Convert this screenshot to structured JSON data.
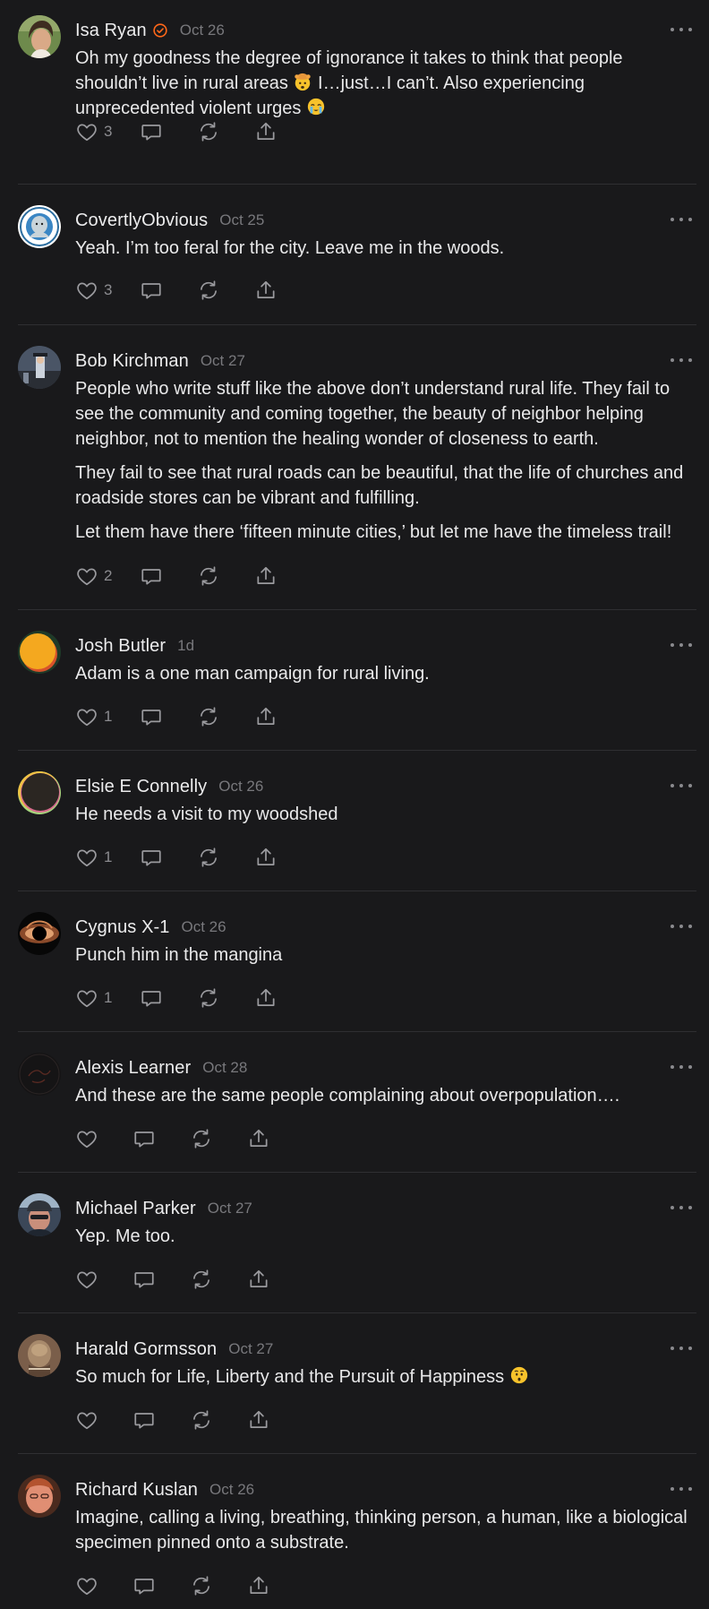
{
  "comments": [
    {
      "author": "Isa Ryan",
      "verified": true,
      "date": "Oct 26",
      "avatar": "avatar-isa",
      "paragraphs": [
        [
          {
            "t": "Oh my goodness the degree of ignorance it takes to think that people shouldn’t live in rural areas "
          },
          {
            "emoji": "exploding-head"
          },
          {
            "t": " I…just…I can’t. Also experiencing unprecedented violent urges "
          },
          {
            "emoji": "crying-face"
          }
        ]
      ],
      "likes": "3"
    },
    {
      "author": "CovertlyObvious",
      "date": "Oct 25",
      "avatar": "avatar-covertly",
      "paragraphs": [
        [
          {
            "t": "Yeah. I’m too feral for the city. Leave me in the woods."
          }
        ]
      ],
      "likes": "3"
    },
    {
      "author": "Bob Kirchman",
      "date": "Oct 27",
      "avatar": "avatar-bob",
      "paragraphs": [
        [
          {
            "t": "People who write stuff like the above don’t understand rural life. They fail to see the community and coming together, the beauty of neighbor helping neighbor, not to mention the healing wonder of closeness to earth."
          }
        ],
        [
          {
            "t": "They fail to see that rural roads can be beautiful, that the life of churches and roadside stores can be vibrant and fulfilling."
          }
        ],
        [
          {
            "t": "Let them have there ‘fifteen minute cities,’ but let me have the timeless trail!"
          }
        ]
      ],
      "likes": "2"
    },
    {
      "author": "Josh Butler",
      "date": "1d",
      "avatar": "avatar-josh",
      "paragraphs": [
        [
          {
            "t": "Adam is a one man campaign for rural living."
          }
        ]
      ],
      "likes": "1"
    },
    {
      "author": "Elsie E Connelly",
      "date": "Oct 26",
      "avatar": "avatar-elsie",
      "paragraphs": [
        [
          {
            "t": "He needs a visit to my woodshed"
          }
        ]
      ],
      "likes": "1"
    },
    {
      "author": "Cygnus X-1",
      "date": "Oct 26",
      "avatar": "avatar-cygnus",
      "paragraphs": [
        [
          {
            "t": "Punch him in the mangina"
          }
        ]
      ],
      "likes": "1"
    },
    {
      "author": "Alexis Learner",
      "date": "Oct 28",
      "avatar": "avatar-alexis",
      "paragraphs": [
        [
          {
            "t": "And these are the same people complaining about overpopulation…."
          }
        ]
      ],
      "likes": ""
    },
    {
      "author": "Michael Parker",
      "date": "Oct 27",
      "avatar": "avatar-michael",
      "paragraphs": [
        [
          {
            "t": "Yep. Me too."
          }
        ]
      ],
      "likes": ""
    },
    {
      "author": "Harald Gormsson",
      "date": "Oct 27",
      "avatar": "avatar-harald",
      "paragraphs": [
        [
          {
            "t": "So much for Life, Liberty and the Pursuit of Happiness "
          },
          {
            "emoji": "hushed-face"
          }
        ]
      ],
      "likes": ""
    },
    {
      "author": "Richard Kuslan",
      "date": "Oct 26",
      "avatar": "avatar-richard",
      "paragraphs": [
        [
          {
            "t": "Imagine, calling a living, breathing, thinking person, a human, like a biological specimen pinned onto a substrate."
          }
        ]
      ],
      "likes": ""
    }
  ],
  "colors": {
    "background": "#19191b",
    "text": "#e9e9ea",
    "muted": "#78787c",
    "icon": "#9a9a9e",
    "verified": "#ff6719",
    "divider": "#2f2f32"
  }
}
